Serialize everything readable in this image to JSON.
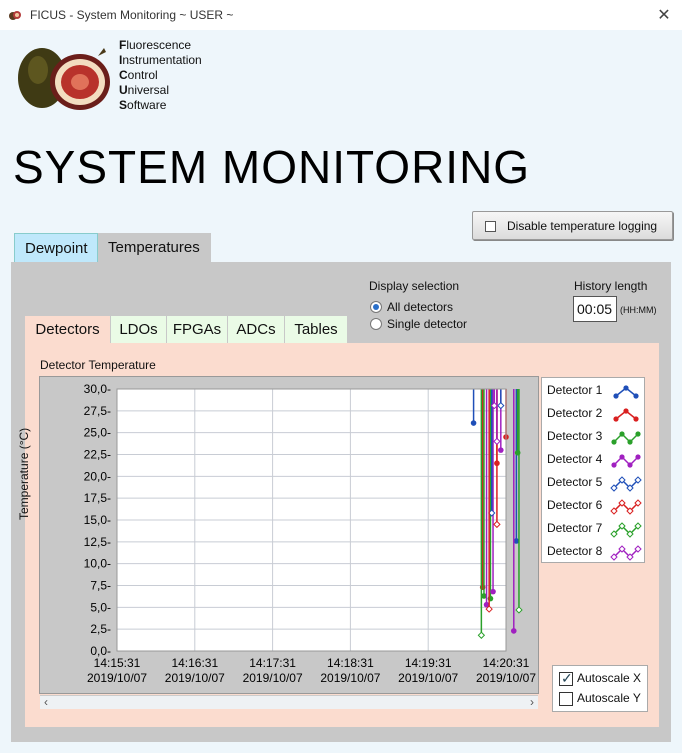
{
  "window": {
    "title": "FICUS - System Monitoring ~ USER ~"
  },
  "logo": {
    "lines": [
      {
        "cap": "F",
        "rest": "luorescence"
      },
      {
        "cap": "I",
        "rest": "nstrumentation"
      },
      {
        "cap": "C",
        "rest": "ontrol"
      },
      {
        "cap": "U",
        "rest": "niversal"
      },
      {
        "cap": "S",
        "rest": "oftware"
      }
    ]
  },
  "page_title": "SYSTEM MONITORING",
  "logging_button": {
    "label": "Disable temperature logging",
    "checked": false
  },
  "outer_tabs": [
    {
      "label": "Dewpoint"
    },
    {
      "label": "Temperatures"
    }
  ],
  "display_selection": {
    "title": "Display selection",
    "options": [
      {
        "label": "All detectors",
        "selected": true
      },
      {
        "label": "Single detector",
        "selected": false
      }
    ]
  },
  "history": {
    "label": "History length",
    "value": "00:05",
    "unit": "(HH:MM)"
  },
  "inner_tabs": [
    {
      "label": "Detectors"
    },
    {
      "label": "LDOs"
    },
    {
      "label": "FPGAs"
    },
    {
      "label": "ADCs"
    },
    {
      "label": "Tables"
    }
  ],
  "autoscale": {
    "x_label": "Autoscale X",
    "x_checked": true,
    "y_label": "Autoscale Y",
    "y_checked": false
  },
  "chart_data": {
    "type": "line",
    "title": "Detector Temperature",
    "ylabel": "Temperature (°C)",
    "ylim": [
      0,
      30
    ],
    "y_ticks": [
      "30,0",
      "27,5",
      "25,0",
      "22,5",
      "20,0",
      "17,5",
      "15,0",
      "12,5",
      "10,0",
      "7,5",
      "5,0",
      "2,5",
      "0,0"
    ],
    "x_ticks": [
      {
        "time": "14:15:31",
        "date": "2019/10/07"
      },
      {
        "time": "14:16:31",
        "date": "2019/10/07"
      },
      {
        "time": "14:17:31",
        "date": "2019/10/07"
      },
      {
        "time": "14:18:31",
        "date": "2019/10/07"
      },
      {
        "time": "14:19:31",
        "date": "2019/10/07"
      },
      {
        "time": "14:20:31",
        "date": "2019/10/07"
      }
    ],
    "grid": true,
    "legend_position": "right",
    "series": [
      {
        "name": "Detector 1",
        "color": "#1f4fb8",
        "x_seconds": [
          275,
          308
        ],
        "values": [
          26.1,
          12.6
        ]
      },
      {
        "name": "Detector 2",
        "color": "#d92020",
        "x_seconds": [
          282,
          293,
          300
        ],
        "values": [
          7.3,
          21.5,
          24.5
        ]
      },
      {
        "name": "Detector 3",
        "color": "#2aa02a",
        "x_seconds": [
          283,
          288,
          309
        ],
        "values": [
          6.3,
          6.0,
          22.7
        ]
      },
      {
        "name": "Detector 4",
        "color": "#a020c0",
        "x_seconds": [
          285,
          290,
          296,
          306
        ],
        "values": [
          5.3,
          6.8,
          23.0,
          2.3
        ]
      },
      {
        "name": "Detector 5",
        "color": "#1f4fb8",
        "x_seconds": [
          289,
          296
        ],
        "values": [
          15.8,
          28.1
        ]
      },
      {
        "name": "Detector 6",
        "color": "#d92020",
        "x_seconds": [
          287,
          293
        ],
        "values": [
          4.8,
          14.5
        ]
      },
      {
        "name": "Detector 7",
        "color": "#2aa02a",
        "x_seconds": [
          281,
          310
        ],
        "values": [
          1.8,
          4.7
        ]
      },
      {
        "name": "Detector 8",
        "color": "#a020c0",
        "x_seconds": [
          291,
          293
        ],
        "values": [
          28.1,
          24.0
        ]
      }
    ],
    "x_range_seconds": [
      0,
      300
    ]
  }
}
